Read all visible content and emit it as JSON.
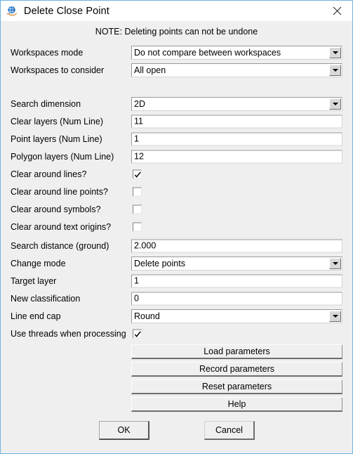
{
  "window": {
    "title": "Delete Close Point",
    "icon": "globe-in-hand-icon",
    "close_icon": "close-icon",
    "note": "NOTE: Deleting points can not be undone",
    "border_color": "#6fb3e0",
    "body_color": "#efefef",
    "titlebar_color": "#ffffff"
  },
  "fields": [
    {
      "label": "Workspaces mode",
      "type": "combo",
      "value": "Do not compare between workspaces",
      "name": "workspaces-mode"
    },
    {
      "label": "Workspaces to consider",
      "type": "combo",
      "value": "All open",
      "name": "workspaces-to-consider"
    },
    {
      "label": "Search dimension",
      "type": "combo",
      "value": "2D",
      "name": "search-dimension"
    },
    {
      "label": "Clear layers (Num Line)",
      "type": "text",
      "value": "11",
      "name": "clear-layers"
    },
    {
      "label": "Point layers (Num Line)",
      "type": "text",
      "value": "1",
      "name": "point-layers"
    },
    {
      "label": "Polygon layers (Num Line)",
      "type": "text",
      "value": "12",
      "name": "polygon-layers"
    },
    {
      "label": "Clear around lines?",
      "type": "checkbox",
      "checked": true,
      "name": "clear-around-lines"
    },
    {
      "label": "Clear around line points?",
      "type": "checkbox",
      "checked": false,
      "name": "clear-around-line-points"
    },
    {
      "label": "Clear around symbols?",
      "type": "checkbox",
      "checked": false,
      "name": "clear-around-symbols"
    },
    {
      "label": "Clear around text origins?",
      "type": "checkbox",
      "checked": false,
      "name": "clear-around-text-origins"
    },
    {
      "label": "Search distance (ground)",
      "type": "text",
      "value": "2.000",
      "name": "search-distance"
    },
    {
      "label": "Change mode",
      "type": "combo",
      "value": "Delete points",
      "name": "change-mode"
    },
    {
      "label": "Target layer",
      "type": "text",
      "value": "1",
      "name": "target-layer"
    },
    {
      "label": "New classification",
      "type": "text",
      "value": "0",
      "name": "new-classification"
    },
    {
      "label": "Line end cap",
      "type": "combo",
      "value": "Round",
      "name": "line-end-cap"
    },
    {
      "label": "Use threads when processing",
      "type": "checkbox",
      "checked": true,
      "name": "use-threads"
    }
  ],
  "param_buttons": [
    {
      "label": "Load parameters",
      "name": "load-parameters-button"
    },
    {
      "label": "Record parameters",
      "name": "record-parameters-button"
    },
    {
      "label": "Reset parameters",
      "name": "reset-parameters-button"
    },
    {
      "label": "Help",
      "name": "help-button"
    }
  ],
  "dialog_buttons": {
    "ok": "OK",
    "cancel": "Cancel"
  }
}
